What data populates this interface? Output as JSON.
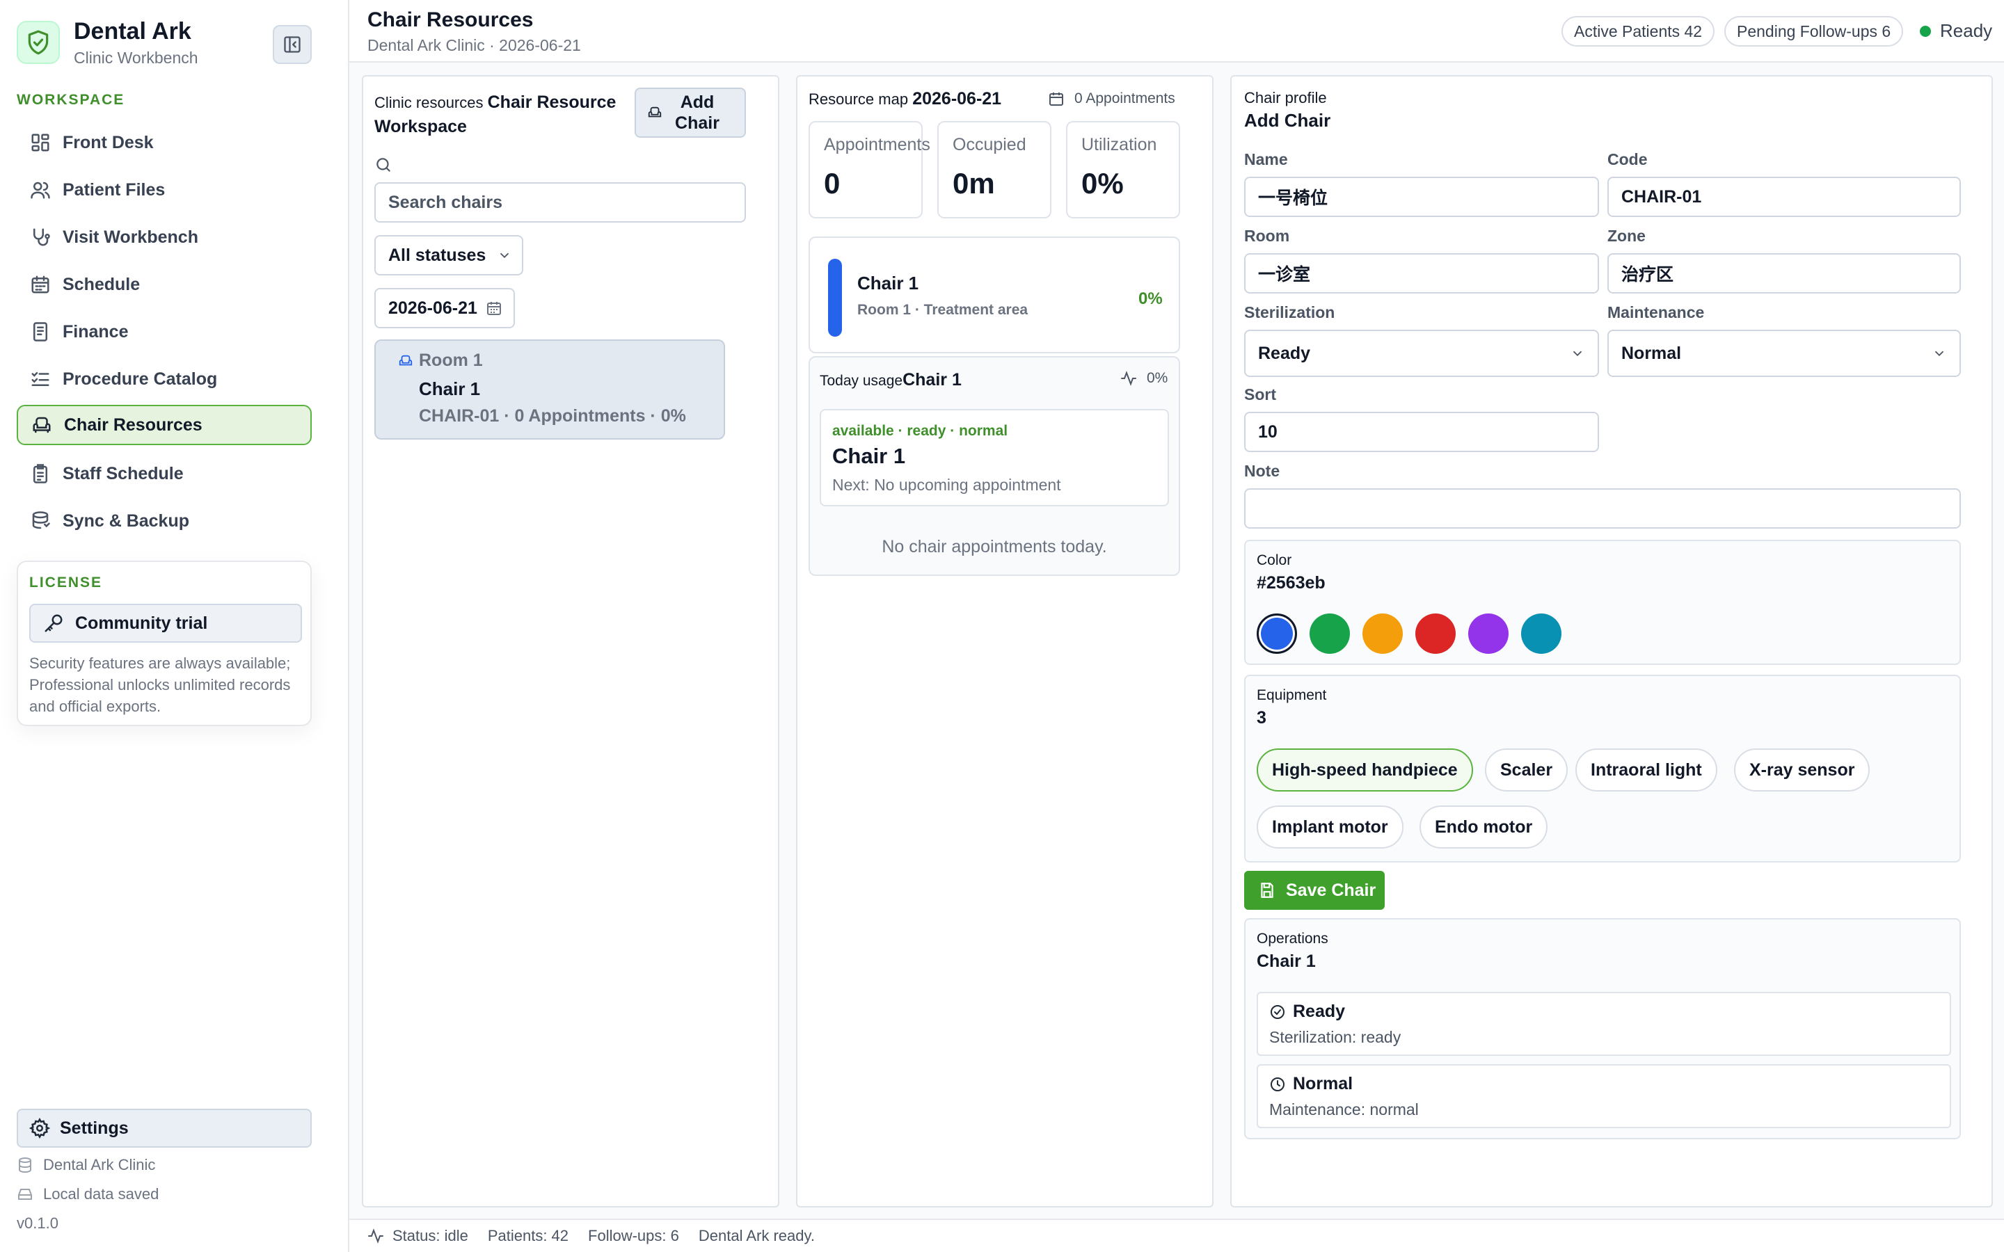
{
  "brand": {
    "name": "Dental Ark",
    "subtitle": "Clinic Workbench"
  },
  "sidebar": {
    "section": "WORKSPACE",
    "items": [
      {
        "label": "Front Desk",
        "icon": "dashboard-icon"
      },
      {
        "label": "Patient Files",
        "icon": "users-icon"
      },
      {
        "label": "Visit Workbench",
        "icon": "stethoscope-icon"
      },
      {
        "label": "Schedule",
        "icon": "calendar-icon"
      },
      {
        "label": "Finance",
        "icon": "receipt-icon"
      },
      {
        "label": "Procedure Catalog",
        "icon": "checklist-icon"
      },
      {
        "label": "Chair Resources",
        "icon": "armchair-icon",
        "active": true
      },
      {
        "label": "Staff Schedule",
        "icon": "clipboard-icon"
      },
      {
        "label": "Sync & Backup",
        "icon": "database-icon"
      }
    ],
    "license": {
      "title": "LICENSE",
      "button": "Community trial",
      "description": "Security features are always available; Professional unlocks unlimited records and official exports."
    },
    "settings": "Settings",
    "clinic": "Dental Ark Clinic",
    "storage": "Local data saved",
    "version": "v0.1.0"
  },
  "header": {
    "title": "Chair Resources",
    "subtitle": "Dental Ark Clinic · 2026-06-21",
    "active_patients": "Active Patients 42",
    "pending_followups": "Pending Follow-ups 6",
    "status": "Ready"
  },
  "resources": {
    "label": "Clinic resources",
    "title": "Chair Resource Workspace",
    "add_button": "Add Chair",
    "search_placeholder": "Search chairs",
    "status_filter": "All statuses",
    "date": "2026-06-21",
    "chairs": [
      {
        "room": "Room 1",
        "name": "Chair 1",
        "meta": "CHAIR-01 · 0 Appointments · 0%"
      }
    ]
  },
  "resource_map": {
    "label": "Resource map",
    "date": "2026-06-21",
    "appointments": "0 Appointments",
    "stats": [
      {
        "label": "Appointments",
        "value": "0"
      },
      {
        "label": "Occupied",
        "value": "0m"
      },
      {
        "label": "Utilization",
        "value": "0%"
      }
    ],
    "chair": {
      "name": "Chair 1",
      "sub": "Room 1 · Treatment area",
      "pct": "0%",
      "color": "#2563eb"
    },
    "usage": {
      "label": "Today usage",
      "chair": "Chair 1",
      "pct": "0%",
      "status": "available · ready · normal",
      "name": "Chair 1",
      "next": "Next: No upcoming appointment",
      "empty": "No chair appointments today."
    }
  },
  "profile": {
    "label": "Chair profile",
    "title": "Add Chair",
    "fields": {
      "name_label": "Name",
      "name_value": "一号椅位",
      "code_label": "Code",
      "code_value": "CHAIR-01",
      "room_label": "Room",
      "room_value": "一诊室",
      "zone_label": "Zone",
      "zone_value": "治疗区",
      "sterilization_label": "Sterilization",
      "sterilization_value": "Ready",
      "maintenance_label": "Maintenance",
      "maintenance_value": "Normal",
      "sort_label": "Sort",
      "sort_value": "10",
      "note_label": "Note",
      "note_value": ""
    },
    "color": {
      "label": "Color",
      "value": "#2563eb",
      "swatches": [
        "#2563eb",
        "#16a34a",
        "#f59e0b",
        "#dc2626",
        "#9333ea",
        "#0891b2"
      ]
    },
    "equipment": {
      "label": "Equipment",
      "count": "3",
      "items": [
        "High-speed handpiece",
        "Scaler",
        "Intraoral light",
        "X-ray sensor",
        "Implant motor",
        "Endo motor"
      ]
    },
    "save_button": "Save Chair",
    "operations": {
      "label": "Operations",
      "chair": "Chair 1",
      "rows": [
        {
          "title": "Ready",
          "desc": "Sterilization: ready",
          "icon": "check-circle-icon"
        },
        {
          "title": "Normal",
          "desc": "Maintenance: normal",
          "icon": "clock-icon"
        }
      ]
    }
  },
  "footer": {
    "status": "Status: idle",
    "patients": "Patients: 42",
    "followups": "Follow-ups: 6",
    "message": "Dental Ark ready."
  }
}
